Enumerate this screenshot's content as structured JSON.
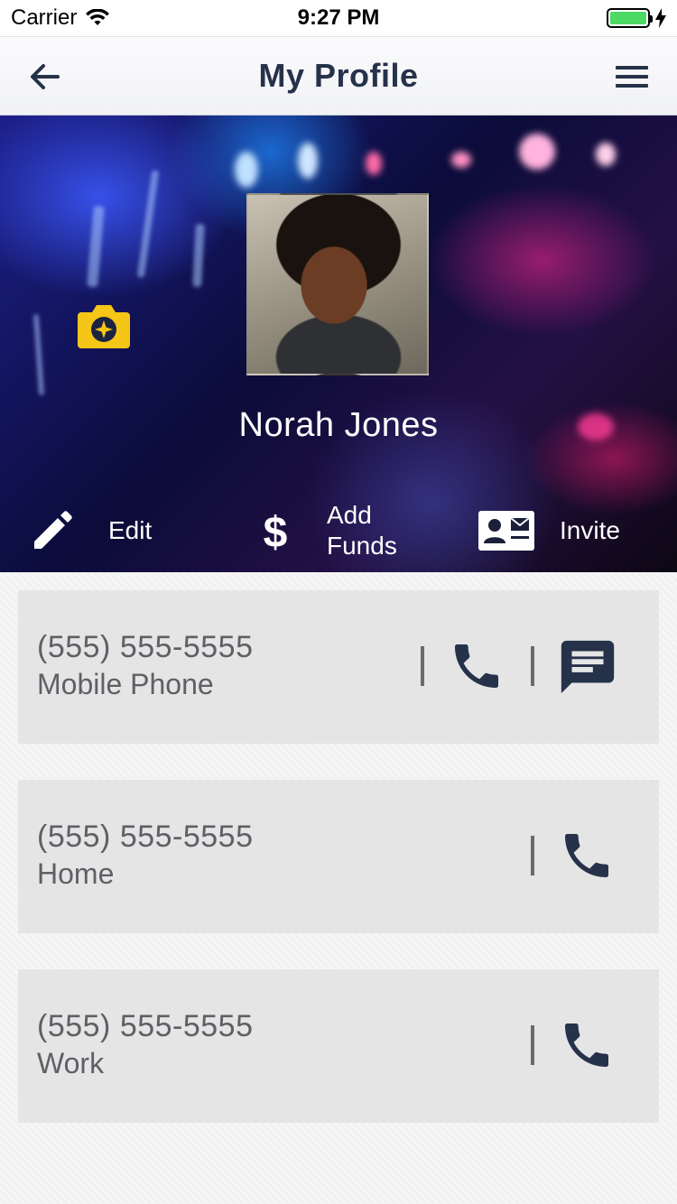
{
  "status_bar": {
    "carrier": "Carrier",
    "time": "9:27 PM",
    "battery_level": 1.0
  },
  "nav": {
    "title": "My Profile",
    "back_icon": "arrow-left-icon",
    "menu_icon": "hamburger-menu-icon"
  },
  "profile": {
    "name": "Norah Jones",
    "camera_icon": "camera-icon"
  },
  "actions": {
    "edit": "Edit",
    "add_funds": "Add Funds",
    "invite": "Invite"
  },
  "contacts": [
    {
      "number": "(555) 555-5555",
      "label": "Mobile Phone",
      "actions": [
        "call",
        "message"
      ]
    },
    {
      "number": "(555) 555-5555",
      "label": "Home",
      "actions": [
        "call"
      ]
    },
    {
      "number": "(555) 555-5555",
      "label": "Work",
      "actions": [
        "call"
      ]
    }
  ],
  "colors": {
    "accent": "#26324a",
    "camera": "#f5c518",
    "card_bg": "#e5e5e5",
    "card_text": "#5f6066"
  }
}
